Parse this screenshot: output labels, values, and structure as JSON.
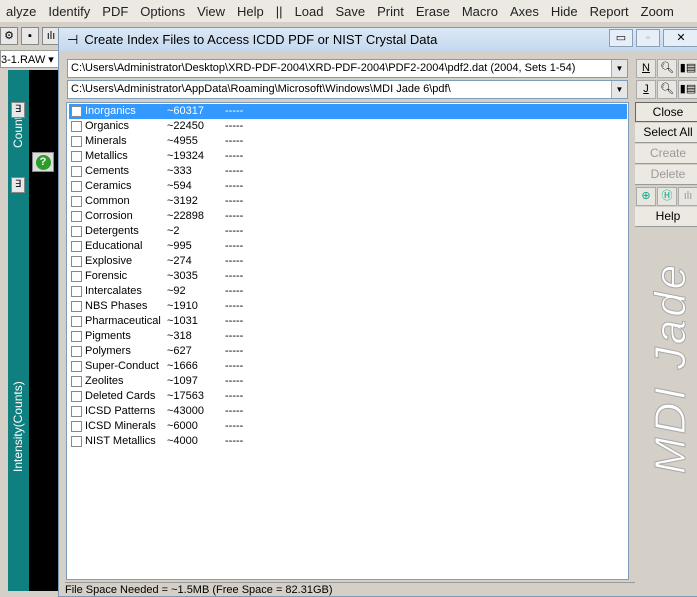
{
  "menu": [
    "alyze",
    "Identify",
    "PDF",
    "Options",
    "View",
    "Help",
    "||",
    "Load",
    "Save",
    "Print",
    "Erase",
    "Macro",
    "Axes",
    "Hide",
    "Report",
    "Zoom"
  ],
  "background": {
    "file": "3-1.RAW",
    "axis_top": "Counts",
    "axis_bottom": "Intensity(Counts)"
  },
  "dialog": {
    "title": "Create Index Files to Access ICDD PDF or NIST Crystal Data",
    "pdf_path": "C:\\Users\\Administrator\\Desktop\\XRD-PDF-2004\\XRD-PDF-2004\\PDF2-2004\\pdf2.dat (2004, Sets 1-54)",
    "index_path": "C:\\Users\\Administrator\\AppData\\Roaming\\Microsoft\\Windows\\MDI Jade 6\\pdf\\",
    "n_btn": "N",
    "j_btn": "J",
    "items": [
      {
        "name": "Inorganics",
        "count": "~60317",
        "status": "-----"
      },
      {
        "name": "Organics",
        "count": "~22450",
        "status": "-----"
      },
      {
        "name": "Minerals",
        "count": "~4955",
        "status": "-----"
      },
      {
        "name": "Metallics",
        "count": "~19324",
        "status": "-----"
      },
      {
        "name": "Cements",
        "count": "~333",
        "status": "-----"
      },
      {
        "name": "Ceramics",
        "count": "~594",
        "status": "-----"
      },
      {
        "name": "Common",
        "count": "~3192",
        "status": "-----"
      },
      {
        "name": "Corrosion",
        "count": "~22898",
        "status": "-----"
      },
      {
        "name": "Detergents",
        "count": "~2",
        "status": "-----"
      },
      {
        "name": "Educational",
        "count": "~995",
        "status": "-----"
      },
      {
        "name": "Explosive",
        "count": "~274",
        "status": "-----"
      },
      {
        "name": "Forensic",
        "count": "~3035",
        "status": "-----"
      },
      {
        "name": "Intercalates",
        "count": "~92",
        "status": "-----"
      },
      {
        "name": "NBS Phases",
        "count": "~1910",
        "status": "-----"
      },
      {
        "name": "Pharmaceutical",
        "count": "~1031",
        "status": "-----"
      },
      {
        "name": "Pigments",
        "count": "~318",
        "status": "-----"
      },
      {
        "name": "Polymers",
        "count": "~627",
        "status": "-----"
      },
      {
        "name": "Super-Conduct",
        "count": "~1666",
        "status": "-----"
      },
      {
        "name": "Zeolites",
        "count": "~1097",
        "status": "-----"
      },
      {
        "name": "Deleted Cards",
        "count": "~17563",
        "status": "-----"
      },
      {
        "name": "ICSD Patterns",
        "count": "~43000",
        "status": "-----"
      },
      {
        "name": "ICSD Minerals",
        "count": "~6000",
        "status": "-----"
      },
      {
        "name": "NIST Metallics",
        "count": "~4000",
        "status": "-----"
      }
    ],
    "buttons": {
      "close": "Close",
      "select_all": "Select All",
      "create": "Create",
      "delete": "Delete",
      "help": "Help"
    },
    "logo": "MDI Jade",
    "status": "File Space Needed = ~1.5MB (Free Space = 82.31GB)"
  }
}
